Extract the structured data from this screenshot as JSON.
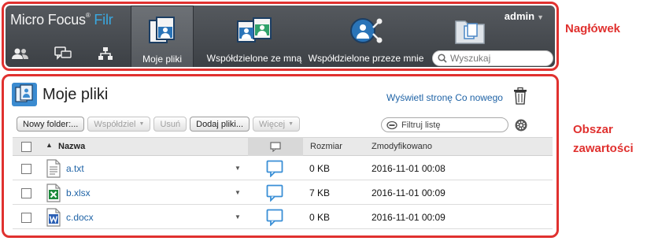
{
  "header": {
    "logo_text": "Micro Focus",
    "logo_product": "Filr",
    "tabs": [
      {
        "label": "Moje pliki",
        "icon": "my-files-icon"
      },
      {
        "label": "Współdzielone ze mną",
        "icon": "shared-with-me-icon"
      },
      {
        "label": "Współdzielone przeze mnie",
        "icon": "shared-by-me-icon"
      },
      {
        "label": "",
        "icon": "net-folders-icon"
      }
    ],
    "small_icons": [
      "people-icon",
      "comments-icon",
      "org-chart-icon"
    ],
    "user": "admin",
    "search_placeholder": "Wyszukaj"
  },
  "content": {
    "title": "Moje pliki",
    "whats_new_link": "Wyświetl stronę Co nowego",
    "toolbar": {
      "new_folder": "Nowy folder:...",
      "share": "Współdziel",
      "delete": "Usuń",
      "add_files": "Dodaj pliki...",
      "more": "Więcej"
    },
    "filter_placeholder": "Filtruj listę",
    "columns": {
      "name": "Nazwa",
      "size": "Rozmiar",
      "modified": "Zmodyfikowano"
    },
    "rows": [
      {
        "name": "a.txt",
        "size": "0 KB",
        "modified": "2016-11-01 00:08",
        "type": "text-file-icon"
      },
      {
        "name": "b.xlsx",
        "size": "7 KB",
        "modified": "2016-11-01 00:09",
        "type": "excel-file-icon"
      },
      {
        "name": "c.docx",
        "size": "0 KB",
        "modified": "2016-11-01 00:09",
        "type": "word-file-icon"
      }
    ]
  },
  "annotations": {
    "header_label": "Nagłówek",
    "content_label_1": "Obszar",
    "content_label_2": "zawartości"
  },
  "colors": {
    "annotation": "#e0312f",
    "link": "#1f63a6",
    "header_bg": "#45494e",
    "accent": "#3aa8e0"
  }
}
